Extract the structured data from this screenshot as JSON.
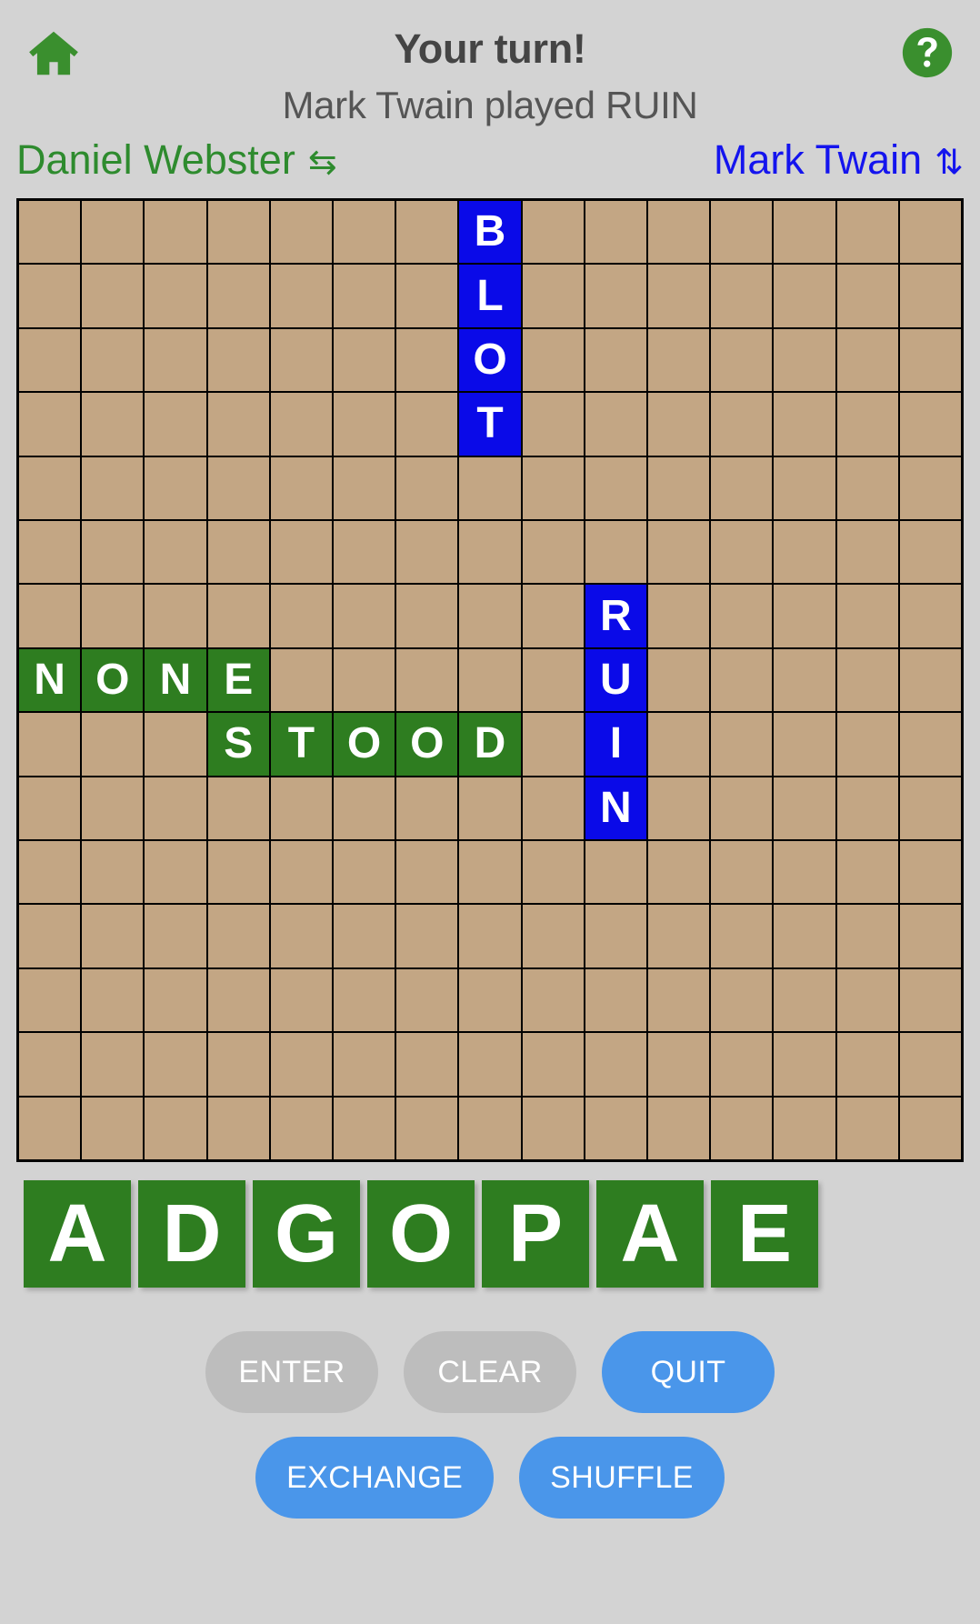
{
  "header": {
    "home_icon": "home-icon",
    "help_icon": "question-mark-circle-icon",
    "turn_title": "Your turn!",
    "last_move": "Mark Twain played RUIN"
  },
  "players": {
    "left": {
      "name": "Daniel Webster",
      "direction_icon": "⇆",
      "color": "#2e8b2e"
    },
    "right": {
      "name": "Mark Twain",
      "direction_icon": "⇅",
      "color": "#1414ee"
    }
  },
  "board": {
    "rows": 15,
    "cols": 15,
    "empty_color": "#c3a684",
    "grid_line_color": "#000000",
    "player_tile_color": "#2e7d20",
    "opponent_tile_color": "#0a0ae8",
    "words": [
      {
        "text": "BLOT",
        "row": 0,
        "col": 7,
        "orientation": "vertical",
        "owner": "Mark Twain",
        "style": "blue"
      },
      {
        "text": "RUIN",
        "row": 6,
        "col": 9,
        "orientation": "vertical",
        "owner": "Mark Twain",
        "style": "blue"
      },
      {
        "text": "NONE",
        "row": 7,
        "col": 0,
        "orientation": "horizontal",
        "owner": "Daniel Webster",
        "style": "green"
      },
      {
        "text": "STOOD",
        "row": 8,
        "col": 3,
        "orientation": "horizontal",
        "owner": "Daniel Webster",
        "style": "green"
      }
    ]
  },
  "rack": {
    "tiles": [
      "A",
      "D",
      "G",
      "O",
      "P",
      "A",
      "E"
    ],
    "tile_color": "#2e7d20"
  },
  "buttons": {
    "row1": [
      {
        "label": "ENTER",
        "state": "disabled",
        "color": "#bdbdbd"
      },
      {
        "label": "CLEAR",
        "state": "disabled",
        "color": "#bdbdbd"
      },
      {
        "label": "QUIT",
        "state": "enabled",
        "color": "#4a96ea"
      }
    ],
    "row2": [
      {
        "label": "EXCHANGE",
        "state": "enabled",
        "color": "#4a96ea"
      },
      {
        "label": "SHUFFLE",
        "state": "enabled",
        "color": "#4a96ea"
      }
    ]
  }
}
